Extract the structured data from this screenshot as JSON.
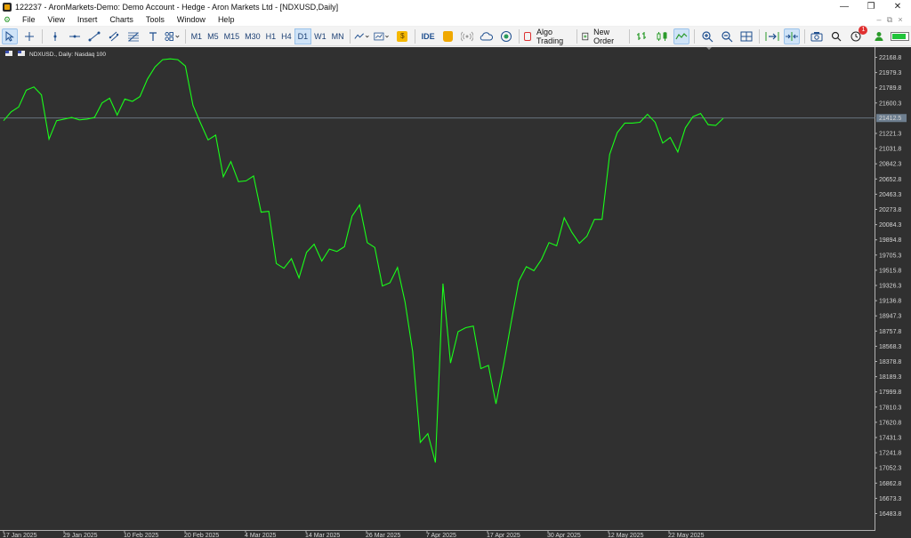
{
  "window": {
    "title": "122237 - AronMarkets-Demo: Demo Account - Hedge - Aron Markets Ltd - [NDXUSD,Daily]",
    "controls": [
      "—",
      "❐",
      "✕"
    ]
  },
  "menu": {
    "items": [
      "File",
      "View",
      "Insert",
      "Charts",
      "Tools",
      "Window",
      "Help"
    ],
    "mdi_controls": [
      "–",
      "⧉",
      "×"
    ]
  },
  "toolbar": {
    "timeframes": [
      "M1",
      "M5",
      "M15",
      "M30",
      "H1",
      "H4",
      "D1",
      "W1",
      "MN"
    ],
    "active_timeframe": "D1",
    "ide_label": "IDE",
    "algo_trading_label": "Algo Trading",
    "new_order_label": "New Order",
    "notification_count": "1",
    "icons": [
      "cursor-icon",
      "crosshair-icon",
      "vertical-line-icon",
      "horizontal-line-icon",
      "trend-line-icon",
      "channel-icon",
      "fibonacci-icon",
      "text-icon",
      "shapes-icon",
      "indicators-icon",
      "templates-icon",
      "market-icon",
      "bag-icon",
      "signals-icon",
      "cloud-icon",
      "vps-icon",
      "bar-chart-icon",
      "candle-chart-icon",
      "line-chart-icon",
      "zoom-in-icon",
      "zoom-out-icon",
      "tile-windows-icon",
      "scroll-icon",
      "autoscroll-icon",
      "screenshot-icon",
      "search-icon",
      "notifications-icon",
      "profile-icon",
      "signal-strength-icon"
    ]
  },
  "chart": {
    "header_text": "NDXUSD., Daily:  Nasdaq 100",
    "current_price_label": "21412.5",
    "colors": {
      "background": "#303030",
      "line": "#19ff19",
      "current_price_line": "#7a8a99",
      "axis_text": "#d6d6d6"
    }
  },
  "chart_data": {
    "type": "line",
    "title": "",
    "symbol": "NDXUSD.",
    "timeframe": "Daily",
    "instrument_name": "Nasdaq 100",
    "xlabel": "",
    "ylabel": "",
    "ylim": [
      16300,
      22350
    ],
    "y_tick_labels": [
      "22168.8",
      "21979.3",
      "21789.8",
      "21600.3",
      "21221.3",
      "21031.8",
      "20842.3",
      "20652.8",
      "20463.3",
      "20273.8",
      "20084.3",
      "19894.8",
      "19705.3",
      "19515.8",
      "19326.3",
      "19136.8",
      "18947.3",
      "18757.8",
      "18568.3",
      "18378.8",
      "18189.3",
      "17999.8",
      "17810.3",
      "17620.8",
      "17431.3",
      "17241.8",
      "17052.3",
      "16862.8",
      "16673.3",
      "16483.8"
    ],
    "x_tick_labels": [
      "17 Jan 2025",
      "29 Jan 2025",
      "10 Feb 2025",
      "20 Feb 2025",
      "4 Mar 2025",
      "14 Mar 2025",
      "26 Mar 2025",
      "7 Apr 2025",
      "17 Apr 2025",
      "30 Apr 2025",
      "12 May 2025",
      "22 May 2025"
    ],
    "current_price": 21412.5,
    "grid": false,
    "series": [
      {
        "values": [
          21380,
          21490,
          21550,
          21760,
          21800,
          21700,
          21150,
          21380,
          21400,
          21420,
          21390,
          21400,
          21420,
          21600,
          21660,
          21450,
          21650,
          21620,
          21680,
          21900,
          22050,
          22140,
          22150,
          22140,
          22060,
          21570,
          21350,
          21140,
          21200,
          20680,
          20870,
          20620,
          20630,
          20690,
          20240,
          20250,
          19600,
          19540,
          19660,
          19420,
          19740,
          19840,
          19630,
          19780,
          19750,
          19810,
          20190,
          20330,
          19860,
          19800,
          19320,
          19360,
          19550,
          19120,
          18500,
          17370,
          17480,
          17120,
          19350,
          18360,
          18750,
          18800,
          18820,
          18290,
          18330,
          17850,
          18330,
          18870,
          19380,
          19560,
          19510,
          19650,
          19860,
          19820,
          20170,
          19990,
          19850,
          19940,
          20150,
          20150,
          20960,
          21230,
          21350,
          21350,
          21360,
          21460,
          21360,
          21100,
          21170,
          20990,
          21290,
          21430,
          21470,
          21330,
          21320,
          21410
        ]
      }
    ]
  }
}
